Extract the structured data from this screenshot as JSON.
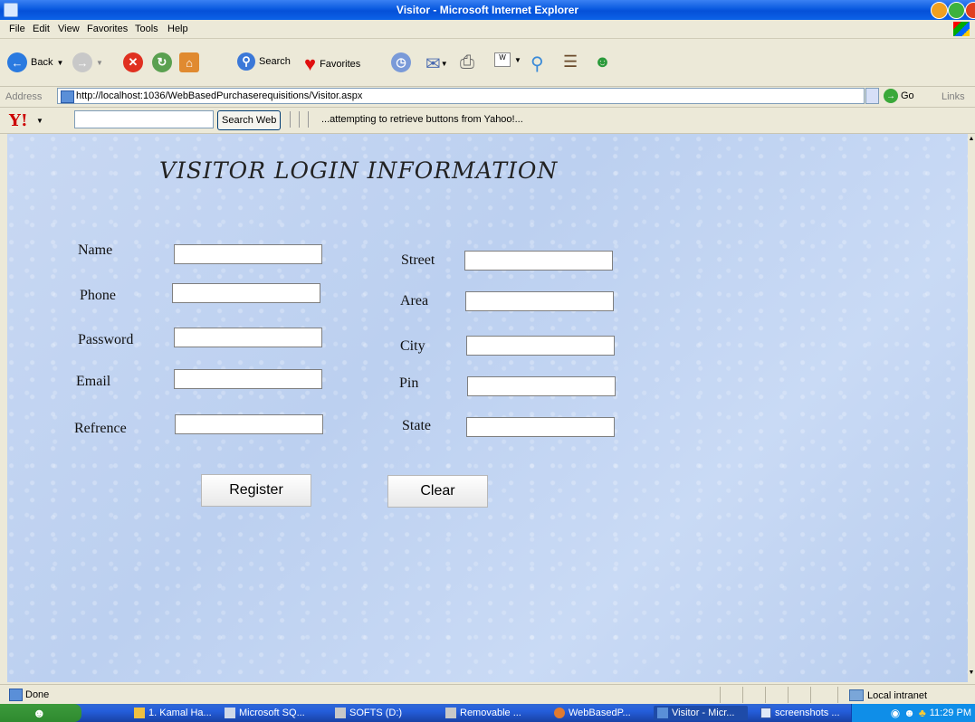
{
  "window": {
    "title": "Visitor - Microsoft Internet Explorer"
  },
  "menu": [
    "File",
    "Edit",
    "View",
    "Favorites",
    "Tools",
    "Help"
  ],
  "toolbar": {
    "back_label": "Back",
    "search_label": "Search",
    "favorites_label": "Favorites"
  },
  "address": {
    "label": "Address",
    "url": "http://localhost:1036/WebBasedPurchaserequisitions/Visitor.aspx",
    "go_label": "Go",
    "links_label": "Links"
  },
  "yahoo": {
    "logo": "Y!",
    "search_button": "Search Web",
    "status": "...attempting to retrieve buttons from Yahoo!..."
  },
  "page": {
    "title": "VISITOR LOGIN INFORMATION",
    "left_fields": [
      {
        "label": "Name",
        "value": ""
      },
      {
        "label": "Phone",
        "value": ""
      },
      {
        "label": "Password",
        "value": ""
      },
      {
        "label": "Email",
        "value": ""
      },
      {
        "label": "Refrence",
        "value": ""
      }
    ],
    "right_fields": [
      {
        "label": "Street",
        "value": ""
      },
      {
        "label": "Area",
        "value": ""
      },
      {
        "label": "City",
        "value": ""
      },
      {
        "label": "Pin",
        "value": ""
      },
      {
        "label": "State",
        "value": ""
      }
    ],
    "register_label": "Register",
    "clear_label": "Clear"
  },
  "status": {
    "text": "Done",
    "zone": "Local intranet"
  },
  "taskbar": {
    "items": [
      "1. Kamal Ha...",
      "Microsoft SQ...",
      "SOFTS (D:)",
      "Removable ...",
      "WebBasedP...",
      "Visitor - Micr...",
      "screenshots ..."
    ],
    "clock": "11:29 PM"
  },
  "colors": {
    "titlebar": "#0a5ae0",
    "content_bg": "#c4d6f2",
    "taskbar": "#245edb"
  }
}
